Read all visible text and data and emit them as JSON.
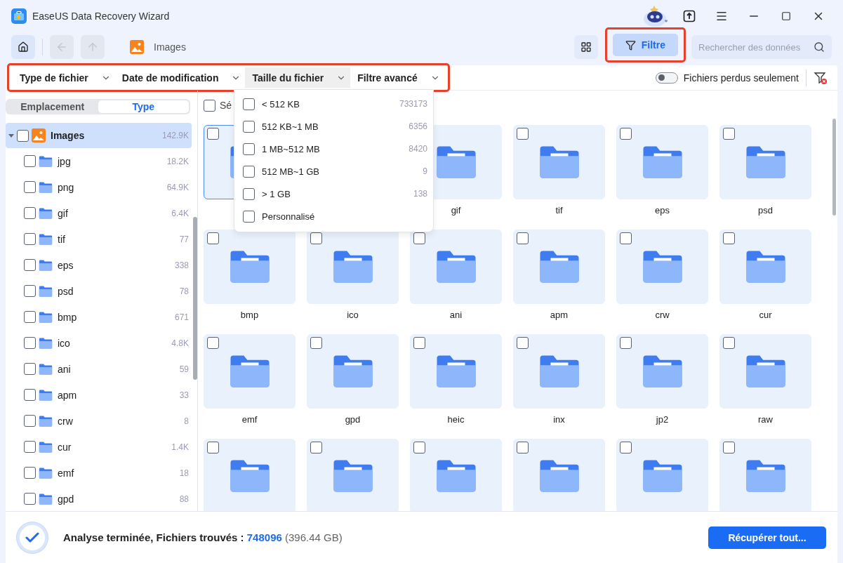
{
  "window": {
    "title": "EaseUS Data Recovery Wizard"
  },
  "toolbar": {
    "breadcrumb": "Images",
    "filter_button": {
      "label": "Filtre",
      "selected": true
    },
    "search": {
      "placeholder": "Rechercher des données"
    }
  },
  "filters": [
    {
      "label": "Type de fichier",
      "open": false
    },
    {
      "label": "Date de modification",
      "open": false
    },
    {
      "label": "Taille du fichier",
      "open": true
    },
    {
      "label": "Filtre avancé",
      "open": false
    }
  ],
  "lost_only": {
    "label": "Fichiers perdus seulement",
    "on": false
  },
  "size_menu": [
    {
      "label": "< 512 KB",
      "count": "733173",
      "checked": false
    },
    {
      "label": "512 KB~1 MB",
      "count": "6356",
      "checked": false
    },
    {
      "label": "1 MB~512 MB",
      "count": "8420",
      "checked": false
    },
    {
      "label": "512 MB~1 GB",
      "count": "9",
      "checked": false
    },
    {
      "label": "> 1 GB",
      "count": "138",
      "checked": false
    },
    {
      "label": "Personnalisé",
      "checked": false
    }
  ],
  "sidebar": {
    "tabs": [
      {
        "label": "Emplacement",
        "selected": false
      },
      {
        "label": "Type",
        "selected": true
      }
    ],
    "tree": [
      {
        "label": "Images",
        "count": "142.9K",
        "expanded": true,
        "checked": false,
        "selected": true,
        "children": [
          {
            "label": "jpg",
            "count": "18.2K",
            "checked": false
          },
          {
            "label": "png",
            "count": "64.9K",
            "checked": false
          },
          {
            "label": "gif",
            "count": "6.4K",
            "checked": false
          },
          {
            "label": "tif",
            "count": "77",
            "checked": false
          },
          {
            "label": "eps",
            "count": "338",
            "checked": false
          },
          {
            "label": "psd",
            "count": "78",
            "checked": false
          },
          {
            "label": "bmp",
            "count": "671",
            "checked": false
          },
          {
            "label": "ico",
            "count": "4.8K",
            "checked": false
          },
          {
            "label": "ani",
            "count": "59",
            "checked": false
          },
          {
            "label": "apm",
            "count": "33",
            "checked": false
          },
          {
            "label": "crw",
            "count": "8",
            "checked": false
          },
          {
            "label": "cur",
            "count": "1.4K",
            "checked": false
          },
          {
            "label": "emf",
            "count": "18",
            "checked": false
          },
          {
            "label": "gpd",
            "count": "88",
            "checked": false
          }
        ]
      }
    ]
  },
  "grid": {
    "select_all": {
      "label": "Sé",
      "checked": false
    },
    "items": [
      {
        "kind": "folder",
        "checked": false,
        "selected": true
      },
      {
        "kind": "covered"
      },
      {
        "kind": "folder",
        "label": "gif",
        "selected": false
      },
      {
        "kind": "folder",
        "label": "tif",
        "checked": false,
        "selected": false
      },
      {
        "kind": "folder",
        "label": "eps",
        "checked": false,
        "selected": false
      },
      {
        "kind": "folder",
        "label": "psd",
        "checked": false,
        "selected": false
      },
      {
        "kind": "folder",
        "label": "bmp",
        "checked": false,
        "selected": false
      },
      {
        "kind": "folder",
        "label": "ico",
        "checked": false,
        "selected": false
      },
      {
        "kind": "folder",
        "label": "ani",
        "checked": false,
        "selected": false
      },
      {
        "kind": "folder",
        "label": "apm",
        "checked": false,
        "selected": false
      },
      {
        "kind": "folder",
        "label": "crw",
        "checked": false,
        "selected": false
      },
      {
        "kind": "folder",
        "label": "cur",
        "checked": false,
        "selected": false
      },
      {
        "kind": "folder",
        "label": "emf",
        "checked": false,
        "selected": false
      },
      {
        "kind": "folder",
        "label": "gpd",
        "checked": false,
        "selected": false
      },
      {
        "kind": "folder",
        "label": "heic",
        "checked": false,
        "selected": false
      },
      {
        "kind": "folder",
        "label": "inx",
        "checked": false,
        "selected": false
      },
      {
        "kind": "folder",
        "label": "jp2",
        "checked": false,
        "selected": false
      },
      {
        "kind": "folder",
        "label": "raw",
        "checked": false,
        "selected": false
      },
      {
        "kind": "folder",
        "checked": false,
        "selected": false
      },
      {
        "kind": "folder",
        "checked": false,
        "selected": false
      },
      {
        "kind": "folder",
        "checked": false,
        "selected": false
      },
      {
        "kind": "folder",
        "checked": false,
        "selected": false
      },
      {
        "kind": "folder",
        "checked": false,
        "selected": false
      },
      {
        "kind": "folder",
        "checked": false,
        "selected": false
      }
    ]
  },
  "status": {
    "text": "Analyse terminée, Fichiers trouvés :",
    "count": "748096",
    "size": "(396.44 GB)"
  },
  "recover_button": "Récupérer tout..."
}
